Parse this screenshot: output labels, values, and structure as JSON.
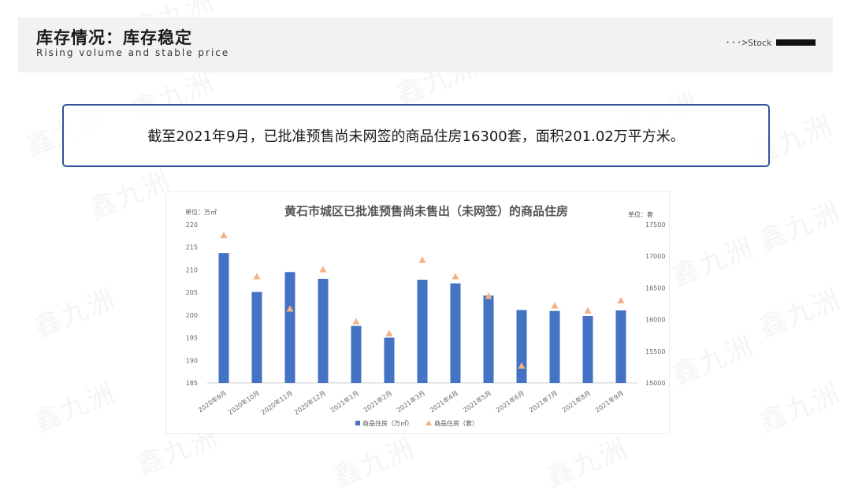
{
  "header": {
    "title": "库存情况：库存稳定",
    "subtitle": "Rising volume and stable price",
    "nav_arrow": "···>",
    "nav_label": "Stock"
  },
  "callout": {
    "text": "截至2021年9月，已批准预售尚未网签的商品住房16300套，面积201.02万平方米。"
  },
  "watermark": {
    "text": "鑫九洲"
  },
  "colors": {
    "bar": "#4472c4",
    "marker": "#f4b183",
    "callout_border": "#2f5597",
    "header_bg": "#f2f2f2"
  },
  "chart_data": {
    "type": "bar",
    "title": "黄石市城区已批准预售尚未售出（未网签）的商品住房",
    "left_unit": "单位：万㎡",
    "right_unit": "单位：套",
    "categories": [
      "2020年9月",
      "2020年10月",
      "2020年11月",
      "2020年12月",
      "2021年1月",
      "2021年2月",
      "2021年3月",
      "2021年4月",
      "2021年5月",
      "2021年6月",
      "2021年7月",
      "2021年8月",
      "2021年9月"
    ],
    "ylim": [
      185,
      220
    ],
    "yticks": [
      "185",
      "190",
      "195",
      "200",
      "205",
      "210",
      "215",
      "220"
    ],
    "y2lim": [
      15000,
      17500
    ],
    "y2ticks": [
      "15000",
      "15500",
      "16000",
      "16500",
      "17000",
      "17500"
    ],
    "series": [
      {
        "name": "商品住房（万㎡）",
        "type": "bar",
        "axis": "left",
        "values": [
          213.7,
          205.1,
          209.5,
          208.0,
          197.6,
          195.0,
          207.8,
          207.0,
          204.3,
          201.1,
          200.9,
          199.8,
          201.02
        ]
      },
      {
        "name": "商品住房（套）",
        "type": "scatter",
        "axis": "right",
        "marker": "triangle",
        "values": [
          17330,
          16680,
          16170,
          16790,
          15970,
          15780,
          16940,
          16680,
          16370,
          15270,
          16220,
          16140,
          16300
        ]
      }
    ],
    "legend_position": "bottom",
    "grid": false
  }
}
